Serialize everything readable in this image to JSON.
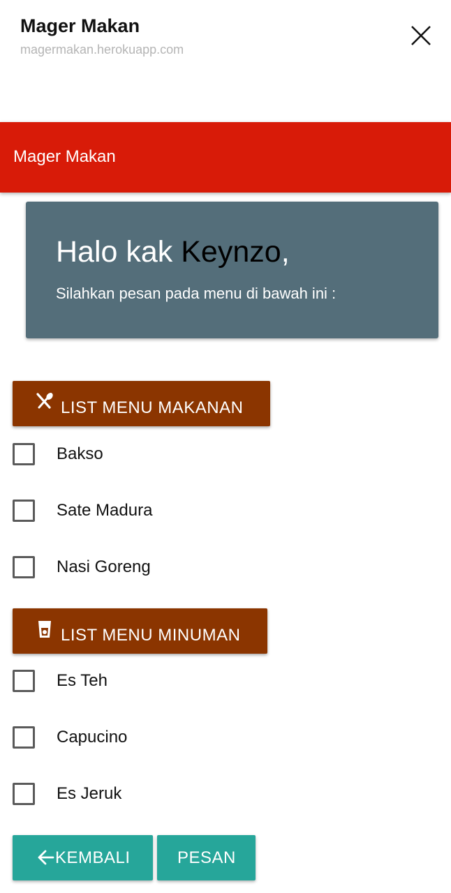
{
  "browser": {
    "title": "Mager Makan",
    "url": "magermakan.herokuapp.com",
    "close_icon": "close-icon"
  },
  "app_bar": {
    "title": "Mager Makan",
    "color": "#d81b08"
  },
  "welcome": {
    "greeting_prefix": "Halo kak ",
    "user_name": "Keynzo",
    "greeting_suffix": ",",
    "instruction": "Silahkan pesan pada menu di bawah ini :",
    "color": "#546e7a"
  },
  "food_section": {
    "label": "LIST MENU MAKANAN",
    "icon": "utensils-icon",
    "items": [
      {
        "label": "Bakso",
        "checked": false
      },
      {
        "label": "Sate Madura",
        "checked": false
      },
      {
        "label": "Nasi Goreng",
        "checked": false
      }
    ]
  },
  "drink_section": {
    "label": "LIST MENU MINUMAN",
    "icon": "drink-cup-icon",
    "items": [
      {
        "label": "Es Teh",
        "checked": false
      },
      {
        "label": "Capucino",
        "checked": false
      },
      {
        "label": "Es Jeruk",
        "checked": false
      }
    ]
  },
  "actions": {
    "back_label": "KEMBALI",
    "back_icon": "arrow-left-icon",
    "order_label": "PESAN",
    "color": "#26a69a"
  },
  "section_color": "#8b3500"
}
